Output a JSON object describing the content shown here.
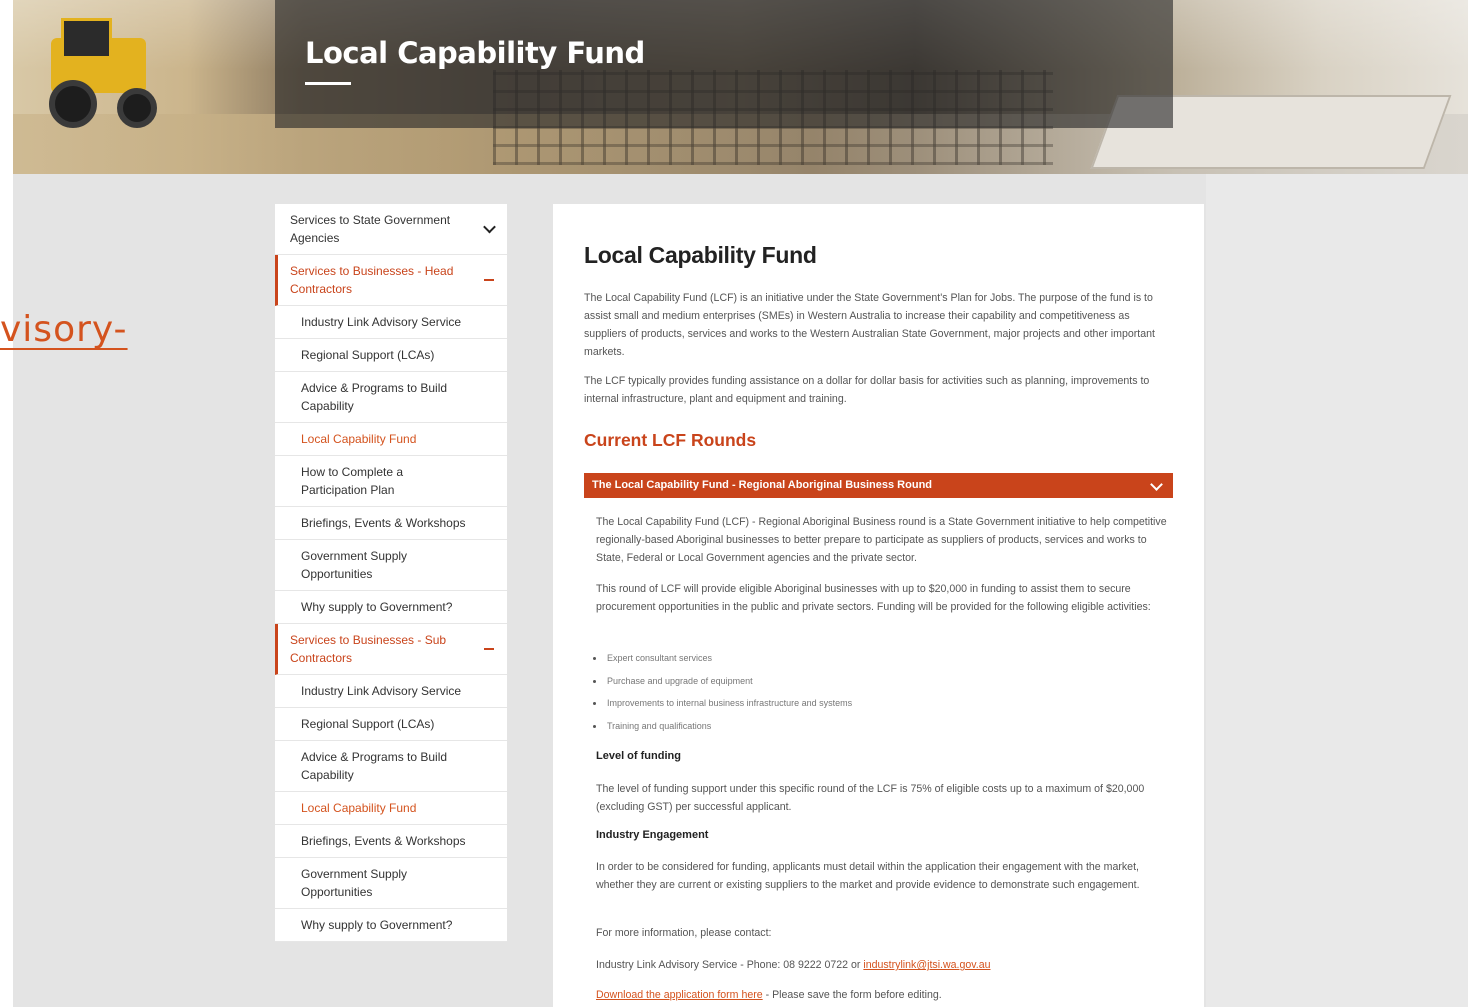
{
  "hero": {
    "title": "Local Capability Fund"
  },
  "stray_link_text": "visory-",
  "sidebar": {
    "items": [
      {
        "label": "Services to State Government Agencies",
        "type": "parent",
        "toggle": "chevron"
      },
      {
        "label": "Services to Businesses - Head Contractors",
        "type": "parent",
        "open": true,
        "toggle": "minus"
      },
      {
        "label": "Industry Link Advisory Service",
        "type": "child"
      },
      {
        "label": "Regional Support (LCAs)",
        "type": "child"
      },
      {
        "label": "Advice & Programs to Build Capability",
        "type": "child"
      },
      {
        "label": "Local Capability Fund",
        "type": "child",
        "active": true
      },
      {
        "label": "How to Complete a Participation Plan",
        "type": "child"
      },
      {
        "label": "Briefings, Events & Workshops",
        "type": "child"
      },
      {
        "label": "Government Supply Opportunities",
        "type": "child"
      },
      {
        "label": "Why supply to Government?",
        "type": "child"
      },
      {
        "label": "Services to Businesses - Sub Contractors",
        "type": "parent",
        "open": true,
        "toggle": "minus"
      },
      {
        "label": "Industry Link Advisory Service",
        "type": "child"
      },
      {
        "label": "Regional Support (LCAs)",
        "type": "child"
      },
      {
        "label": "Advice & Programs to Build Capability",
        "type": "child"
      },
      {
        "label": "Local Capability Fund",
        "type": "child",
        "active": true
      },
      {
        "label": "Briefings, Events & Workshops",
        "type": "child"
      },
      {
        "label": "Government Supply Opportunities",
        "type": "child"
      },
      {
        "label": "Why supply to Government?",
        "type": "child"
      }
    ]
  },
  "main": {
    "heading": "Local Capability Fund",
    "intro_1": "The Local Capability Fund (LCF) is an initiative under the State Government's Plan for Jobs. The purpose of the fund is to assist small and medium enterprises (SMEs) in Western Australia to increase their capability and competitiveness as suppliers of products, services and works to the Western Australian State Government, major projects and other important markets.",
    "intro_2": "The LCF typically provides funding assistance on a dollar for dollar basis for activities such as planning, improvements to internal infrastructure, plant and equipment and training.",
    "section_heading": "Current LCF Rounds",
    "accordion": {
      "title": "The Local Capability Fund - Regional Aboriginal Business Round",
      "p1": "The Local Capability Fund (LCF) - Regional Aboriginal Business round is a State Government initiative to help competitive regionally-based Aboriginal businesses to better prepare to participate as suppliers of products, services and works to State, Federal or Local Government agencies and the private sector.",
      "p2": "This round of LCF will provide eligible Aboriginal businesses with up to $20,000 in funding to assist them to secure procurement opportunities in the public and private sectors. Funding will be provided for the following eligible activities:",
      "bullets": [
        "Expert consultant services",
        "Purchase and upgrade of equipment",
        "Improvements to internal business infrastructure and systems",
        "Training and qualifications"
      ],
      "funding_heading": "Level of funding",
      "funding_text": "The level of funding support under this specific round of the LCF is 75% of eligible costs up to a maximum of $20,000 (excluding GST) per successful applicant.",
      "engagement_heading": "Industry Engagement",
      "engagement_text": "In order to be considered for funding, applicants must detail within the application their engagement with the market, whether they are current or existing suppliers to the market and provide evidence to demonstrate such engagement.",
      "contact_intro": "For more information, please contact:",
      "contact_prefix": "Industry Link Advisory Service - Phone: 08 9222 0722 or ",
      "contact_email": "industrylink@jtsi.wa.gov.au",
      "download_link": "Download the application form here",
      "download_suffix": " - Please save the form before editing."
    }
  }
}
